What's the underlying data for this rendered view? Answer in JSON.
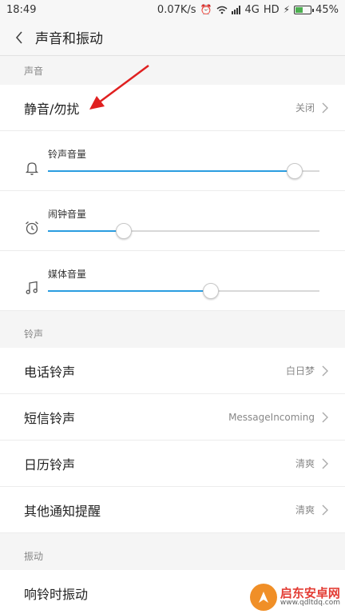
{
  "status": {
    "time": "18:49",
    "network_speed": "0.07K/s",
    "alarm_icon": "alarm-icon",
    "wifi_icon": "wifi-icon",
    "signal_icon": "signal-icon",
    "network_type": "4G",
    "hd": "HD",
    "charging_icon": "charging-icon",
    "battery_level": 45,
    "battery_text": "45%"
  },
  "header": {
    "title": "声音和振动",
    "back_icon": "back-chevron-icon"
  },
  "sections": {
    "sound": {
      "title": "声音",
      "dnd": {
        "label": "静音/勿扰",
        "value": "关闭"
      },
      "sliders": [
        {
          "label": "铃声音量",
          "icon": "bell-icon",
          "level": 0.91
        },
        {
          "label": "闹钟音量",
          "icon": "alarm-clock-icon",
          "level": 0.28
        },
        {
          "label": "媒体音量",
          "icon": "music-note-icon",
          "level": 0.6
        }
      ]
    },
    "ringtone": {
      "title": "铃声",
      "items": [
        {
          "label": "电话铃声",
          "value": "白日梦"
        },
        {
          "label": "短信铃声",
          "value": "MessageIncoming"
        },
        {
          "label": "日历铃声",
          "value": "清爽"
        },
        {
          "label": "其他通知提醒",
          "value": "清爽"
        }
      ]
    },
    "vibration": {
      "title": "振动",
      "items": [
        {
          "label": "响铃时振动"
        }
      ]
    }
  },
  "watermark": {
    "name": "启东安卓网",
    "url": "www.qdltdq.com"
  },
  "colors": {
    "accent": "#2a9de0",
    "annotation_arrow": "#e02020",
    "battery": "#4caf50"
  }
}
